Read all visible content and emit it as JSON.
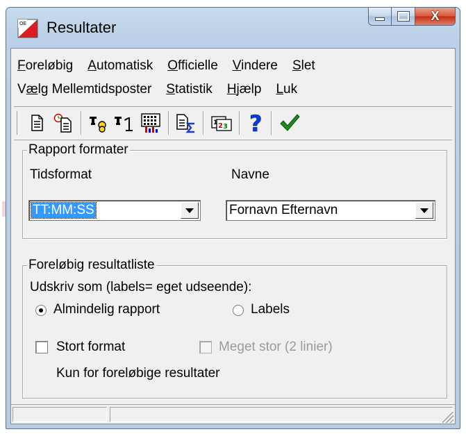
{
  "window": {
    "title": "Resultater",
    "controls": {
      "minimize": "minimize-icon",
      "maximize": "maximize-icon",
      "close": "close-icon"
    }
  },
  "menu": {
    "row1": [
      {
        "label": "Foreløbig",
        "u": "F",
        "rest": "oreløbig"
      },
      {
        "label": "Automatisk",
        "u": "A",
        "rest": "utomatisk"
      },
      {
        "label": "Officielle",
        "u": "O",
        "rest": "fficielle"
      },
      {
        "label": "Vindere",
        "u": "V",
        "rest": "indere"
      },
      {
        "label": "Slet",
        "u": "S",
        "rest": "let"
      }
    ],
    "row2": [
      {
        "label": "Vælg Mellemtidsposter",
        "pre": "V",
        "u": "æ",
        "rest": "lg Mellemtidsposter"
      },
      {
        "label": "Statistik",
        "u": "S",
        "rest": "tatistik"
      },
      {
        "label": "Hjælp",
        "u": "H",
        "rest": "jælp"
      },
      {
        "label": "Luk",
        "u": "L",
        "rest": "uk"
      }
    ]
  },
  "toolbar": {
    "icons": [
      "document-icon",
      "timed-document-icon",
      "trophy-icon",
      "trophy-first-icon",
      "calendar-chart-icon",
      "sum-report-icon",
      "numbered-cards-icon",
      "help-icon",
      "check-icon"
    ]
  },
  "report_format": {
    "legend": "Rapport formater",
    "time_label": "Tidsformat",
    "time_value": "TT:MM:SS",
    "names_label": "Navne",
    "names_value": "Fornavn Efternavn"
  },
  "prelim_list": {
    "legend": "Foreløbig resultatliste",
    "print_as": "Udskriv som (labels= eget udseende):",
    "radio_normal": "Almindelig rapport",
    "radio_labels": "Labels",
    "normal_selected": true,
    "check_large": "Stort format",
    "check_very_large": "Meget stor (2 linier)",
    "note": "Kun for foreløbige resultater"
  },
  "colors": {
    "selection": "#3399ff",
    "close_button": "#c42e12",
    "window_frame": "#bcd1e7"
  }
}
